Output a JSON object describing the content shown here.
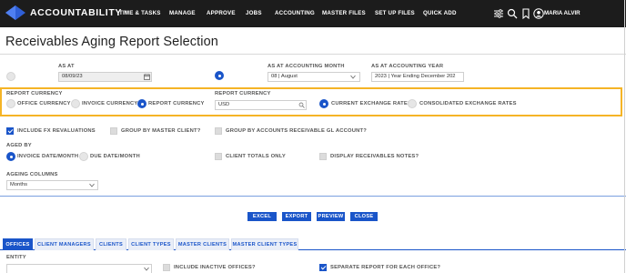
{
  "app": {
    "logo_text": "ACCOUNTABILITY",
    "logo_tm": "™",
    "nav": [
      "TIME & TASKS",
      "MANAGE",
      "APPROVE",
      "JOBS",
      "ACCOUNTING",
      "MASTER FILES",
      "SET UP FILES",
      "QUICK ADD"
    ],
    "user_name": "MARIA ALVIR",
    "icons": [
      "sliders-icon",
      "search-icon",
      "bookmark-icon",
      "user-icon"
    ]
  },
  "page": {
    "title": "Receivables Aging Report Selection"
  },
  "as_at": {
    "label": "AS AT",
    "date_value": "08/09/23",
    "month_label": "AS AT ACCOUNTING MONTH",
    "month_value": "08 | August",
    "year_label": "AS AT ACCOUNTING YEAR",
    "year_value": "2023 | Year Ending December 202",
    "selected": "month"
  },
  "report_currency": {
    "label": "REPORT CURRENCY",
    "options": [
      "OFFICE CURRENCY",
      "INVOICE CURRENCY",
      "REPORT CURRENCY"
    ],
    "selected_index": 2,
    "currency_label": "REPORT CURRENCY",
    "currency_value": "USD",
    "rate_options": [
      "CURRENT EXCHANGE RATES",
      "CONSOLIDATED EXCHANGE RATES"
    ],
    "rate_selected_index": 0
  },
  "options": {
    "include_fx": "INCLUDE FX REVALUATIONS",
    "group_master_client": "GROUP BY MASTER CLIENT?",
    "group_ar_gl": "GROUP BY ACCOUNTS RECEIVABLE GL ACCOUNT?",
    "aged_by_label": "AGED BY",
    "aged_by_options": [
      "INVOICE DATE/MONTH",
      "DUE DATE/MONTH"
    ],
    "aged_by_selected_index": 0,
    "client_totals_only": "CLIENT TOTALS ONLY",
    "display_notes": "DISPLAY RECEIVABLES NOTES?",
    "ageing_columns_label": "AGEING COLUMNS",
    "ageing_columns_value": "Months",
    "include_fx_checked": true
  },
  "actions": [
    "EXCEL",
    "EXPORT",
    "PREVIEW",
    "CLOSE"
  ],
  "tabs": [
    "OFFICES",
    "CLIENT MANAGERS",
    "CLIENTS",
    "CLIENT TYPES",
    "MASTER CLIENTS",
    "MASTER CLIENT TYPES"
  ],
  "active_tab_index": 0,
  "entity": {
    "label": "ENTITY",
    "include_inactive": "INCLUDE INACTIVE OFFICES?",
    "separate_report": "SEPARATE REPORT FOR EACH OFFICE?",
    "separate_report_checked": true
  },
  "colors": {
    "accent": "#1a55c9",
    "topbar": "#1c1c1c",
    "highlight_border": "#f5b426"
  }
}
